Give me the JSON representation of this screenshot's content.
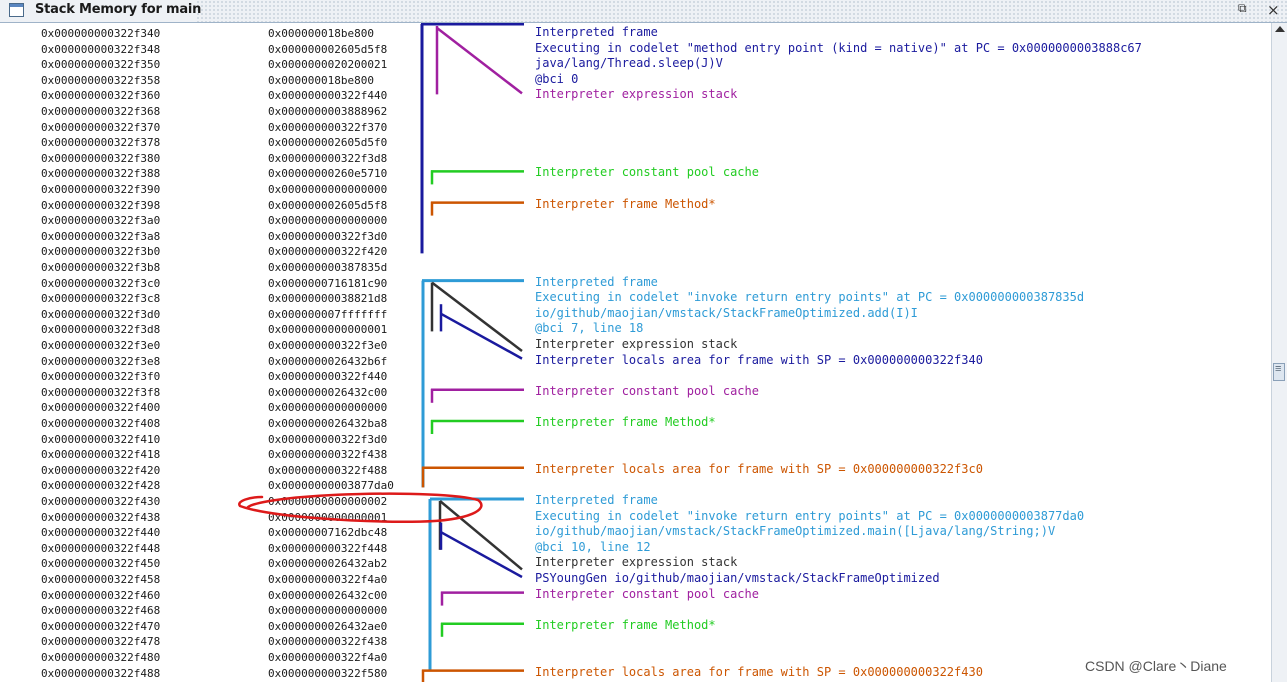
{
  "window": {
    "title": "Stack Memory for main",
    "restore_glyph": "⧉",
    "close_glyph": "×"
  },
  "colors": {
    "navy": "#1a1a9e",
    "purple": "#a020a0",
    "green": "#22cc22",
    "orange": "#cc5500",
    "teal": "#2e9bd6",
    "dark": "#333333",
    "red": "#dd1a1a"
  },
  "rows": [
    {
      "addr": "0x000000000322f340",
      "value": "0x000000018be800"
    },
    {
      "addr": "0x000000000322f348",
      "value": "0x000000002605d5f8"
    },
    {
      "addr": "0x000000000322f350",
      "value": "0x0000000020200021"
    },
    {
      "addr": "0x000000000322f358",
      "value": "0x000000018be800"
    },
    {
      "addr": "0x000000000322f360",
      "value": "0x000000000322f440"
    },
    {
      "addr": "0x000000000322f368",
      "value": "0x0000000003888962"
    },
    {
      "addr": "0x000000000322f370",
      "value": "0x000000000322f370"
    },
    {
      "addr": "0x000000000322f378",
      "value": "0x000000002605d5f0"
    },
    {
      "addr": "0x000000000322f380",
      "value": "0x000000000322f3d8"
    },
    {
      "addr": "0x000000000322f388",
      "value": "0x00000000260e5710"
    },
    {
      "addr": "0x000000000322f390",
      "value": "0x0000000000000000"
    },
    {
      "addr": "0x000000000322f398",
      "value": "0x000000002605d5f8"
    },
    {
      "addr": "0x000000000322f3a0",
      "value": "0x0000000000000000"
    },
    {
      "addr": "0x000000000322f3a8",
      "value": "0x000000000322f3d0"
    },
    {
      "addr": "0x000000000322f3b0",
      "value": "0x000000000322f420"
    },
    {
      "addr": "0x000000000322f3b8",
      "value": "0x000000000387835d"
    },
    {
      "addr": "0x000000000322f3c0",
      "value": "0x0000000716181c90"
    },
    {
      "addr": "0x000000000322f3c8",
      "value": "0x00000000038821d8"
    },
    {
      "addr": "0x000000000322f3d0",
      "value": "0x000000007fffffff"
    },
    {
      "addr": "0x000000000322f3d8",
      "value": "0x0000000000000001"
    },
    {
      "addr": "0x000000000322f3e0",
      "value": "0x000000000322f3e0"
    },
    {
      "addr": "0x000000000322f3e8",
      "value": "0x0000000026432b6f"
    },
    {
      "addr": "0x000000000322f3f0",
      "value": "0x000000000322f440"
    },
    {
      "addr": "0x000000000322f3f8",
      "value": "0x0000000026432c00"
    },
    {
      "addr": "0x000000000322f400",
      "value": "0x0000000000000000"
    },
    {
      "addr": "0x000000000322f408",
      "value": "0x0000000026432ba8"
    },
    {
      "addr": "0x000000000322f410",
      "value": "0x000000000322f3d0"
    },
    {
      "addr": "0x000000000322f418",
      "value": "0x000000000322f438"
    },
    {
      "addr": "0x000000000322f420",
      "value": "0x000000000322f488"
    },
    {
      "addr": "0x000000000322f428",
      "value": "0x00000000003877da0"
    },
    {
      "addr": "0x000000000322f430",
      "value": "0x0000000000000002"
    },
    {
      "addr": "0x000000000322f438",
      "value": "0x0000000000000001"
    },
    {
      "addr": "0x000000000322f440",
      "value": "0x00000007162dbc48"
    },
    {
      "addr": "0x000000000322f448",
      "value": "0x000000000322f448"
    },
    {
      "addr": "0x000000000322f450",
      "value": "0x0000000026432ab2"
    },
    {
      "addr": "0x000000000322f458",
      "value": "0x000000000322f4a0"
    },
    {
      "addr": "0x000000000322f460",
      "value": "0x0000000026432c00"
    },
    {
      "addr": "0x000000000322f468",
      "value": "0x0000000000000000"
    },
    {
      "addr": "0x000000000322f470",
      "value": "0x0000000026432ae0"
    },
    {
      "addr": "0x000000000322f478",
      "value": "0x000000000322f438"
    },
    {
      "addr": "0x000000000322f480",
      "value": "0x000000000322f4a0"
    },
    {
      "addr": "0x000000000322f488",
      "value": "0x000000000322f580"
    }
  ],
  "labels": [
    {
      "row": 0,
      "text": "Interpreted frame",
      "color": "navy"
    },
    {
      "row": 1,
      "text": "Executing in codelet \"method entry point (kind = native)\" at PC = 0x0000000003888c67",
      "color": "navy"
    },
    {
      "row": 2,
      "text": "java/lang/Thread.sleep(J)V",
      "color": "navy"
    },
    {
      "row": 3,
      "text": "@bci 0",
      "color": "navy"
    },
    {
      "row": 4,
      "text": "Interpreter expression stack",
      "color": "purple"
    },
    {
      "row": 9,
      "text": "Interpreter constant pool cache",
      "color": "green"
    },
    {
      "row": 11,
      "text": "Interpreter frame Method*",
      "color": "orange"
    },
    {
      "row": 16,
      "text": "Interpreted frame",
      "color": "teal"
    },
    {
      "row": 17,
      "text": "Executing in codelet \"invoke return entry points\" at PC = 0x000000000387835d",
      "color": "teal"
    },
    {
      "row": 18,
      "text": "io/github/maojian/vmstack/StackFrameOptimized.add(I)I",
      "color": "teal"
    },
    {
      "row": 19,
      "text": "@bci 7, line 18",
      "color": "teal"
    },
    {
      "row": 20,
      "text": "Interpreter expression stack",
      "color": "dark"
    },
    {
      "row": 21,
      "text": "Interpreter locals area for frame with SP = 0x000000000322f340",
      "color": "navy"
    },
    {
      "row": 23,
      "text": "Interpreter constant pool cache",
      "color": "purple"
    },
    {
      "row": 25,
      "text": "Interpreter frame Method*",
      "color": "green"
    },
    {
      "row": 28,
      "text": "Interpreter locals area for frame with SP = 0x000000000322f3c0",
      "color": "orange"
    },
    {
      "row": 30,
      "text": "Interpreted frame",
      "color": "teal"
    },
    {
      "row": 31,
      "text": "Executing in codelet \"invoke return entry points\" at PC = 0x0000000003877da0",
      "color": "teal"
    },
    {
      "row": 32,
      "text": "io/github/maojian/vmstack/StackFrameOptimized.main([Ljava/lang/String;)V",
      "color": "teal"
    },
    {
      "row": 33,
      "text": "@bci 10, line 12",
      "color": "teal"
    },
    {
      "row": 34,
      "text": "Interpreter expression stack",
      "color": "dark"
    },
    {
      "row": 35,
      "text": "PSYoungGen io/github/maojian/vmstack/StackFrameOptimized",
      "color": "navy"
    },
    {
      "row": 36,
      "text": "Interpreter constant pool cache",
      "color": "purple"
    },
    {
      "row": 38,
      "text": "Interpreter frame Method*",
      "color": "green"
    },
    {
      "row": 41,
      "text": "Interpreter locals area for frame with SP = 0x000000000322f430",
      "color": "orange"
    }
  ],
  "watermark": "CSDN @Clare丶Diane"
}
